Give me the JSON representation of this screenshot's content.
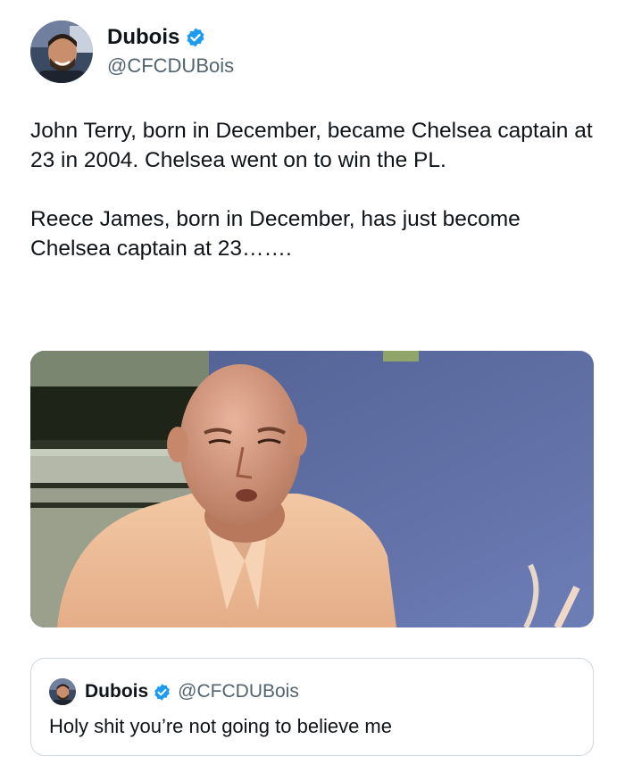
{
  "author": {
    "display_name": "Dubois",
    "handle": "@CFCDUBois",
    "verified": true,
    "avatar_icon": "profile-photo"
  },
  "tweet": {
    "paragraphs": [
      "John Terry, born in December, became Chelsea captain at 23 in 2004. Chelsea went on to win the PL.",
      "Reece James, born in December, has just become Chelsea captain at 23……."
    ]
  },
  "quoted_tweet": {
    "display_name": "Dubois",
    "handle": "@CFCDUBois",
    "verified": true,
    "text": "Holy shit you’re not going to believe me"
  },
  "colors": {
    "verified_badge": "#1d9bf0",
    "handle_text": "#536471",
    "border": "#cfd9de"
  }
}
